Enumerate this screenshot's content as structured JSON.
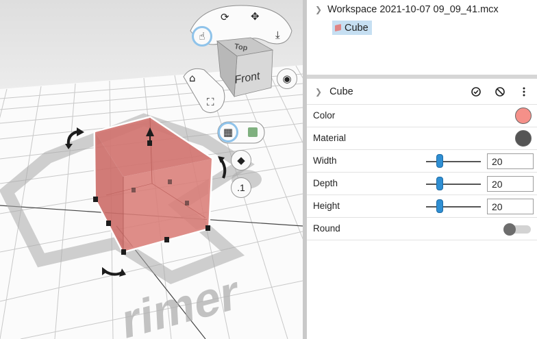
{
  "viewcube": {
    "front_label": "Front",
    "top_label": "Top"
  },
  "viewport": {
    "floor_text": "rimer",
    "tools": {
      "orbit_icon": "orbit-icon",
      "pan_icon": "move-icon",
      "select_icon": "pointer-icon",
      "drop_icon": "drop-to-floor-icon",
      "home_icon": "home-icon",
      "fit_icon": "fit-view-icon",
      "top_view_icon": "disc-icon",
      "grid_icon": "grid-icon",
      "cube_icon": "cube-icon",
      "shape_icon": "shape-icon",
      "snap_label": ".1"
    }
  },
  "tree": {
    "root_label": "Workspace 2021-10-07 09_09_41.mcx",
    "items": [
      {
        "label": "Cube",
        "color": "#e08585"
      }
    ]
  },
  "properties": {
    "title": "Cube",
    "header_icons": [
      "check-circle-icon",
      "hide-icon",
      "more-vert-icon"
    ],
    "rows": {
      "color": {
        "label": "Color",
        "value": "#f59089"
      },
      "material": {
        "label": "Material",
        "value": "#555555"
      },
      "width": {
        "label": "Width",
        "value": "20",
        "slider": 0.25
      },
      "depth": {
        "label": "Depth",
        "value": "20",
        "slider": 0.25
      },
      "height": {
        "label": "Height",
        "value": "20",
        "slider": 0.25
      },
      "round": {
        "label": "Round",
        "value": false
      }
    }
  },
  "colors": {
    "accent": "#2f8fd3",
    "selection": "#c6dff2",
    "cube": "#d77770"
  }
}
